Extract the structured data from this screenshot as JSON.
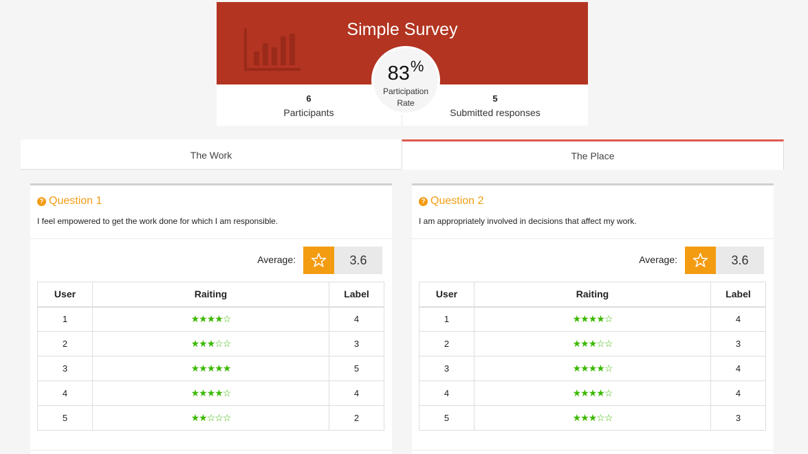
{
  "header": {
    "title": "Simple Survey",
    "rate_value": "83",
    "rate_unit": "%",
    "rate_label": "Participation Rate",
    "participants_count": "6",
    "participants_label": "Participants",
    "submitted_count": "5",
    "submitted_label": "Submitted responses"
  },
  "tabs": [
    {
      "label": "The Work",
      "active": false
    },
    {
      "label": "The Place",
      "active": true
    }
  ],
  "panels": [
    {
      "title": "Question 1",
      "text": "I feel empowered to get the work done for which I am responsible.",
      "average_label": "Average:",
      "average_value": "3.6",
      "columns": [
        "User",
        "Raiting",
        "Label"
      ],
      "rows": [
        {
          "user": "1",
          "rating": 4,
          "label": "4"
        },
        {
          "user": "2",
          "rating": 3,
          "label": "3"
        },
        {
          "user": "3",
          "rating": 5,
          "label": "5"
        },
        {
          "user": "4",
          "rating": 4,
          "label": "4"
        },
        {
          "user": "5",
          "rating": 2,
          "label": "2"
        }
      ]
    },
    {
      "title": "Question 2",
      "text": "I am appropriately involved in decisions that affect my work.",
      "average_label": "Average:",
      "average_value": "3.6",
      "columns": [
        "User",
        "Raiting",
        "Label"
      ],
      "rows": [
        {
          "user": "1",
          "rating": 4,
          "label": "4"
        },
        {
          "user": "2",
          "rating": 3,
          "label": "3"
        },
        {
          "user": "3",
          "rating": 4,
          "label": "4"
        },
        {
          "user": "4",
          "rating": 4,
          "label": "4"
        },
        {
          "user": "5",
          "rating": 3,
          "label": "3"
        }
      ]
    }
  ],
  "icons": {
    "chart": "bar-chart-icon",
    "question": "question-circle-icon",
    "star": "star-icon"
  },
  "colors": {
    "header_bg": "#b23421",
    "accent": "#f39c12",
    "star_green": "#3cb800",
    "tab_active_border": "#e05a4e"
  }
}
